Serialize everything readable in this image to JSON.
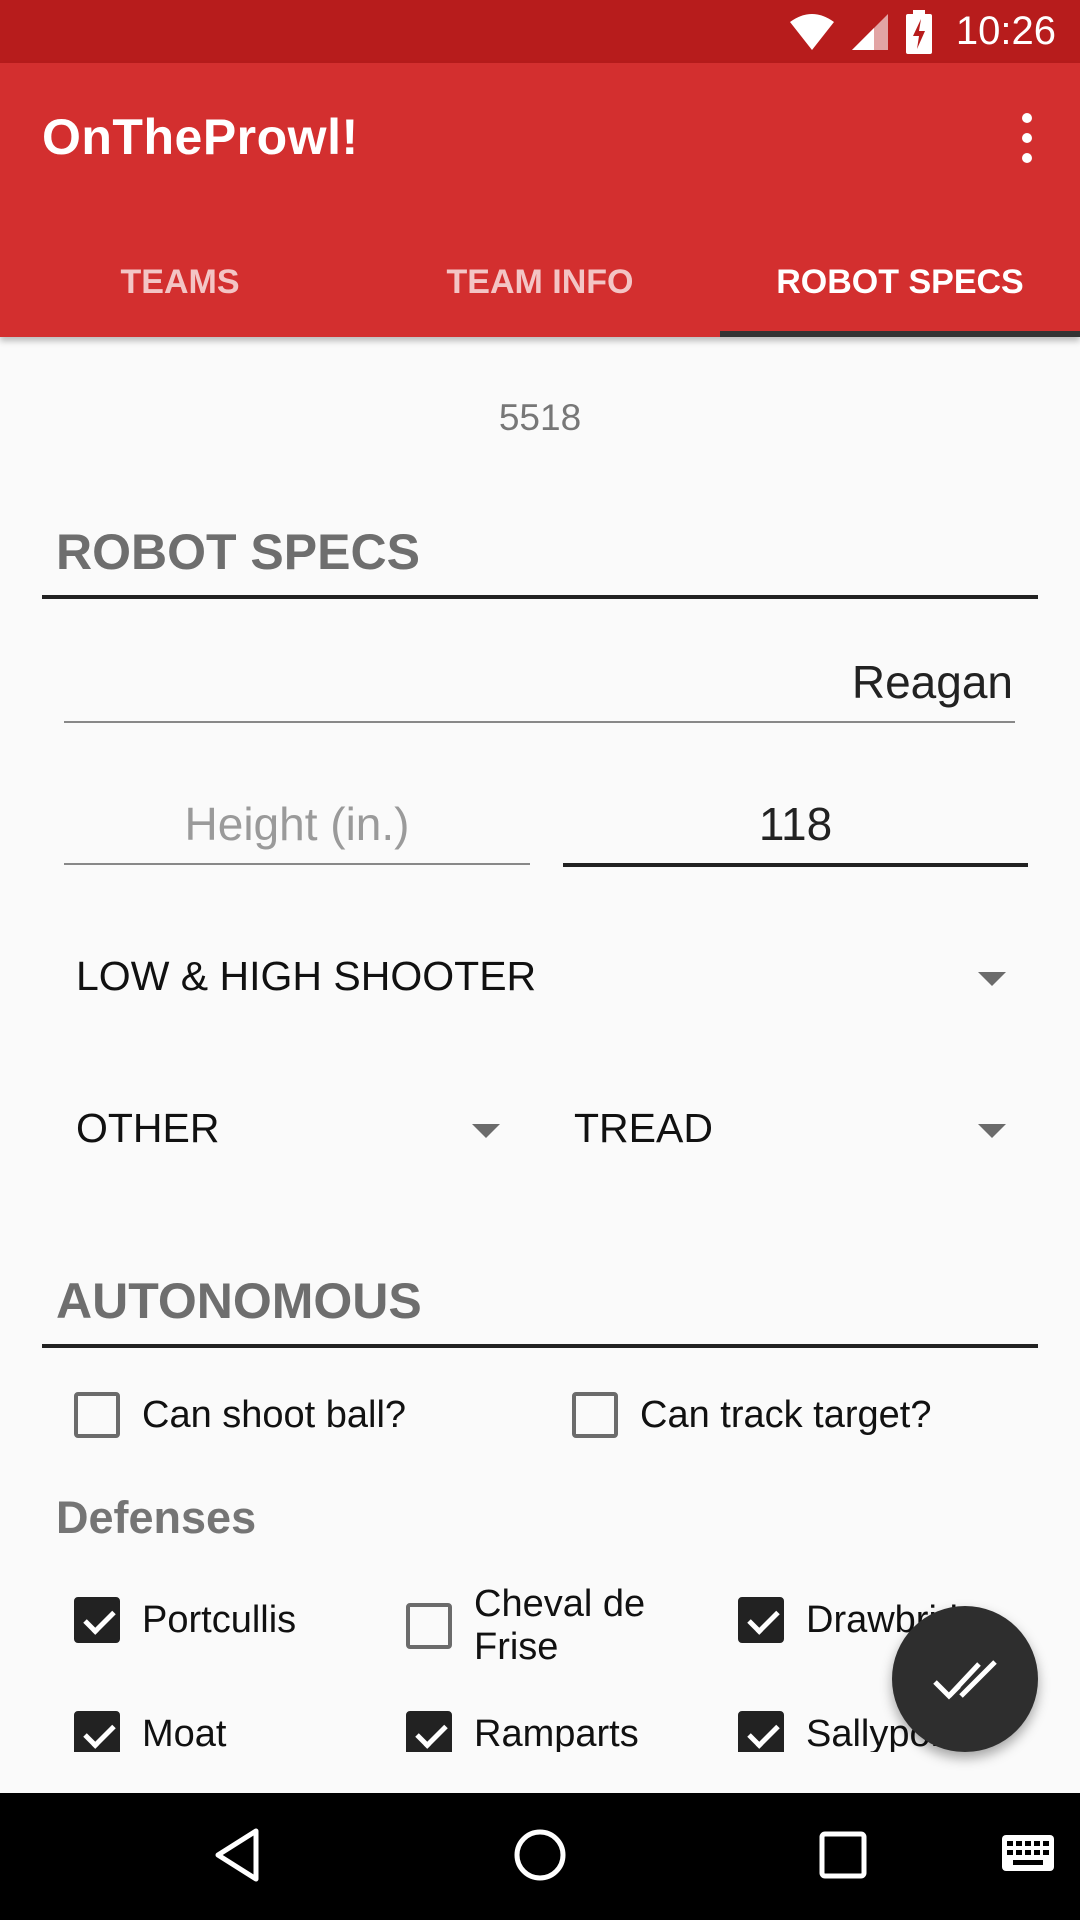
{
  "status_bar": {
    "time": "10:26",
    "icons": [
      "wifi-icon",
      "cell-signal-icon",
      "battery-charging-icon"
    ]
  },
  "app_bar": {
    "title": "OnTheProwl!",
    "overflow_icon": "more-vert-icon"
  },
  "tabs": [
    {
      "label": "TEAMS",
      "active": false
    },
    {
      "label": "TEAM INFO",
      "active": false
    },
    {
      "label": "ROBOT SPECS",
      "active": true
    }
  ],
  "team_number": "5518",
  "robot_specs": {
    "header": "ROBOT SPECS",
    "name_value": "Reagan",
    "height_placeholder": "Height (in.)",
    "weight_value": "118",
    "shooter_select": "LOW & HIGH SHOOTER",
    "select_left": "OTHER",
    "drive_select": "TREAD"
  },
  "autonomous": {
    "header": "AUTONOMOUS",
    "can_shoot_ball": {
      "label": "Can shoot ball?",
      "checked": false
    },
    "can_track_target": {
      "label": "Can track target?",
      "checked": false
    }
  },
  "defenses": {
    "header": "Defenses",
    "items": [
      {
        "label": "Portcullis",
        "checked": true
      },
      {
        "label": "Cheval de Frise",
        "checked": false
      },
      {
        "label": "Drawbridge",
        "checked": true
      },
      {
        "label": "Moat",
        "checked": true
      },
      {
        "label": "Ramparts",
        "checked": true
      },
      {
        "label": "Sallyport",
        "checked": true
      }
    ]
  },
  "fab": {
    "icon": "done-all-icon"
  },
  "nav_bar": {
    "icons": [
      "back-icon",
      "home-icon",
      "recents-icon",
      "keyboard-icon"
    ]
  },
  "colors": {
    "status_bar": "#b71c1c",
    "app_bar": "#d32f2f",
    "background": "#fafafa",
    "fab": "#2e2e2e"
  }
}
